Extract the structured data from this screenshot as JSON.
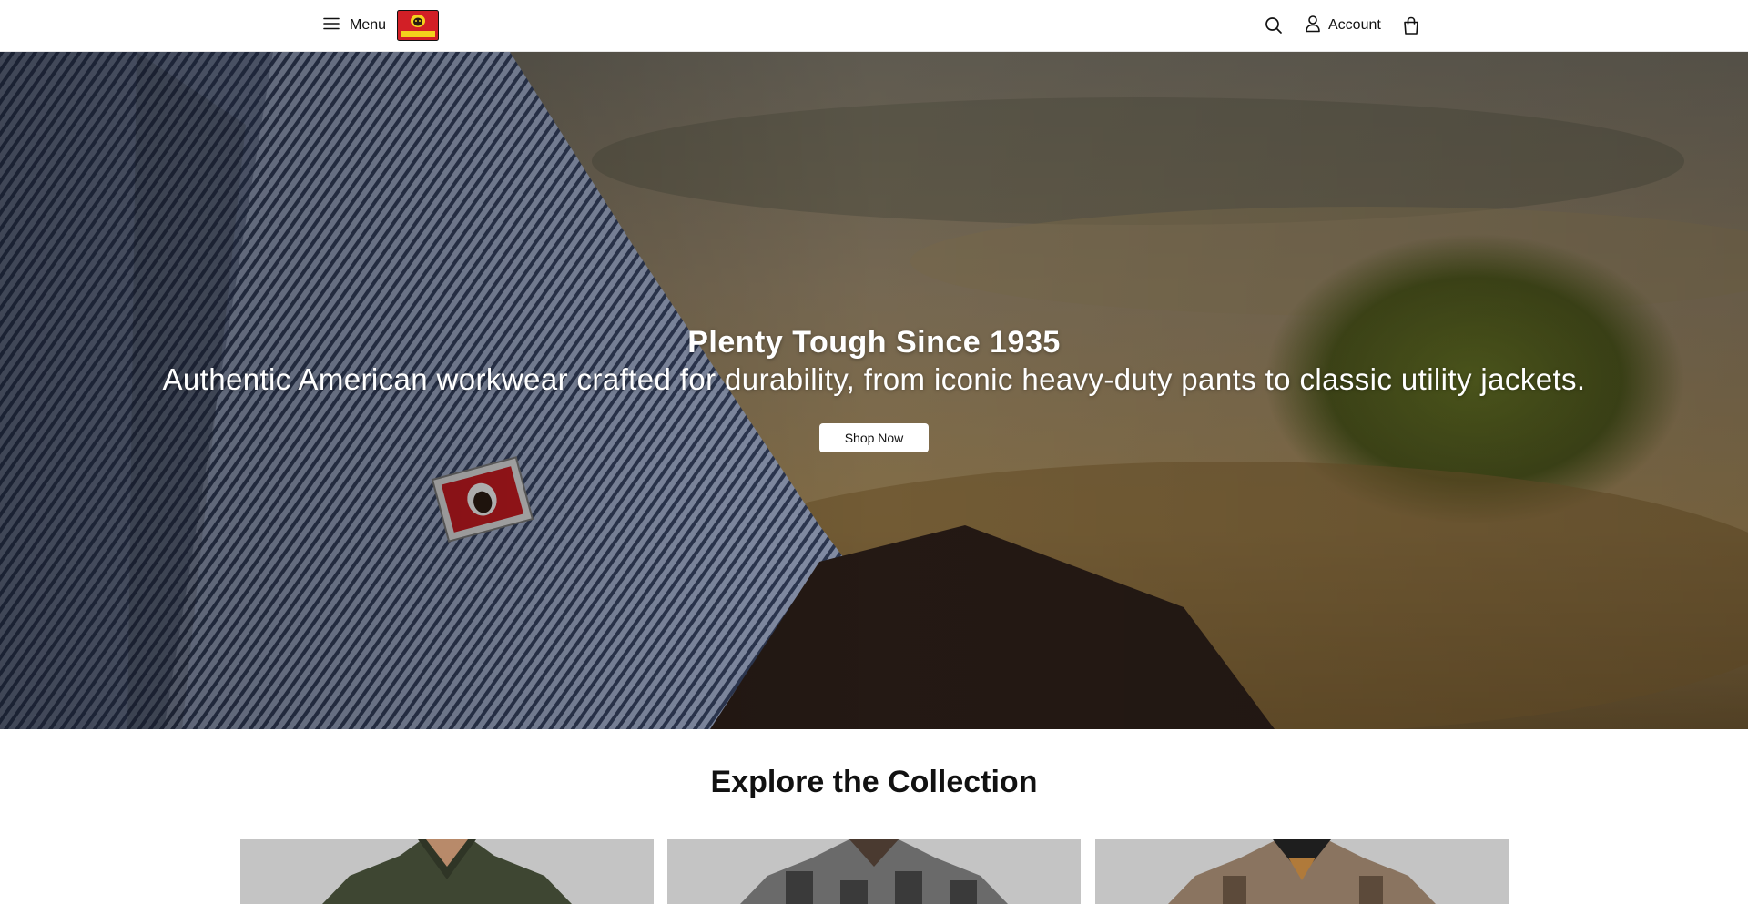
{
  "header": {
    "menu_label": "Menu",
    "logo_text": "BEN DAVIS",
    "account_label": "Account",
    "icons": [
      "hamburger-icon",
      "search-icon",
      "user-icon",
      "shopping-bag-icon"
    ]
  },
  "hero": {
    "title": "Plenty Tough Since 1935",
    "subtitle": "Authentic American workwear crafted for durability, from iconic heavy-duty pants to classic utility jackets.",
    "cta_label": "Shop Now"
  },
  "collection": {
    "title": "Explore the Collection"
  },
  "colors": {
    "header_bg": "#ffffff",
    "hero_text": "#ffffff",
    "cta_bg": "#ffffff",
    "card_bg": "#c4c4c4",
    "logo_red": "#d21f26",
    "logo_yellow": "#f4d21c"
  }
}
